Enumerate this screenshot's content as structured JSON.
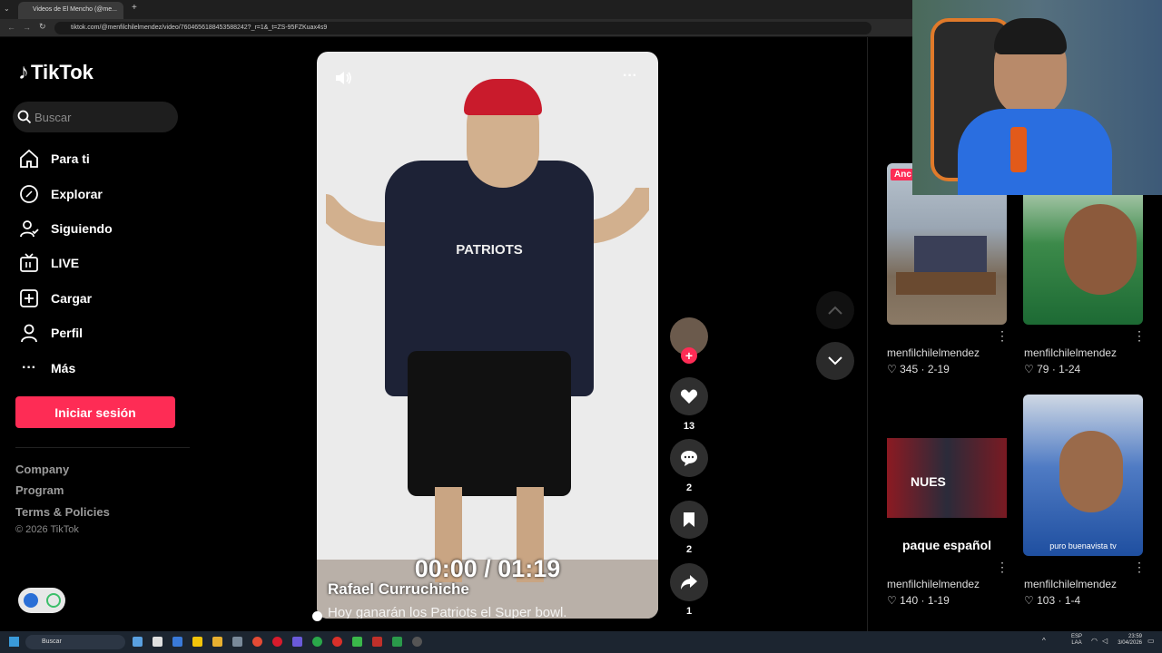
{
  "browser": {
    "tab_title": "Videos de El Mencho (@me...",
    "url": "tiktok.com/@menfilchilelmendez/video/7604656188453588242?_r=1&_t=ZS-95FZKuax4s9"
  },
  "sidebar": {
    "logo": "TikTok",
    "search_placeholder": "Buscar",
    "nav": [
      {
        "label": "Para ti"
      },
      {
        "label": "Explorar"
      },
      {
        "label": "Siguiendo"
      },
      {
        "label": "LIVE"
      },
      {
        "label": "Cargar"
      },
      {
        "label": "Perfil"
      },
      {
        "label": "Más"
      }
    ],
    "login_label": "Iniciar sesión",
    "footer": [
      "Company",
      "Program",
      "Terms & Policies"
    ],
    "copyright": "© 2026 TikTok"
  },
  "video": {
    "timecode": "00:00 / 01:19",
    "author": "Rafael Curruchiche",
    "caption": "Hoy ganarán los Patriots el Super bowl.",
    "shirt_text": "PATRIOTS",
    "progress": 0
  },
  "actions": {
    "likes": "13",
    "comments": "2",
    "saves": "2",
    "shares": "1"
  },
  "related": [
    {
      "user": "menfilchilelmendez",
      "likes": "345",
      "date": "2-19",
      "badge": "Anc",
      "overlay": ""
    },
    {
      "user": "menfilchilelmendez",
      "likes": "79",
      "date": "1-24",
      "badge": "",
      "overlay": ""
    },
    {
      "user": "menfilchilelmendez",
      "likes": "140",
      "date": "1-19",
      "badge": "",
      "overlay": "paque español",
      "inner": "NUES"
    },
    {
      "user": "menfilchilelmendez",
      "likes": "103",
      "date": "1-4",
      "badge": "",
      "overlay": "puro buenavista tv"
    }
  ],
  "taskbar": {
    "search": "Buscar",
    "lang": "ESP",
    "lang2": "LAA",
    "time": "23:59",
    "date": "3/04/2026"
  },
  "colors": {
    "brand": "#fe2c55",
    "background": "#000000"
  }
}
